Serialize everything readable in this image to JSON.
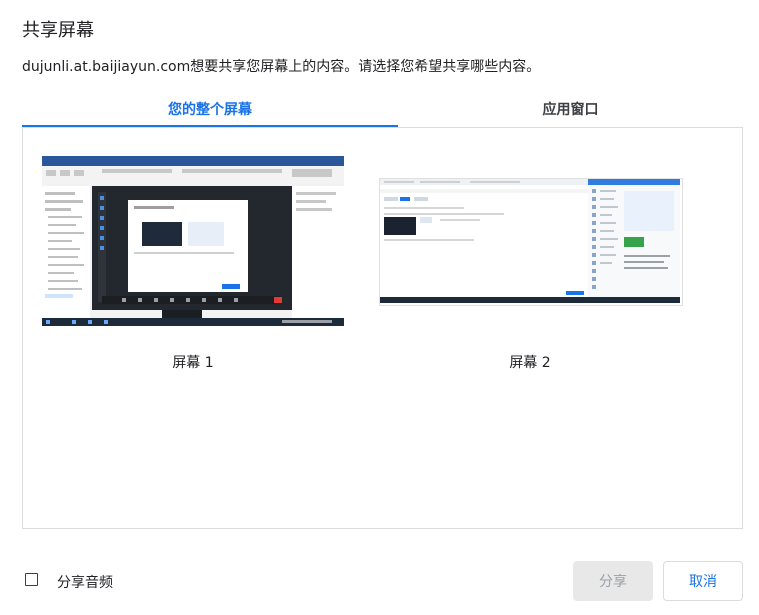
{
  "dialog": {
    "title": "共享屏幕",
    "description": "dujunli.at.baijiayun.com想要共享您屏幕上的内容。请选择您希望共享哪些内容。"
  },
  "tabs": [
    {
      "label": "您的整个屏幕",
      "active": true
    },
    {
      "label": "应用窗口",
      "active": false
    }
  ],
  "screens": [
    {
      "label": "屏幕 1"
    },
    {
      "label": "屏幕 2"
    }
  ],
  "footer": {
    "share_audio_label": "分享音频",
    "share_audio_checked": false,
    "share_button": "分享",
    "cancel_button": "取消"
  },
  "colors": {
    "accent": "#1a73e8",
    "disabled_button_bg": "#e8e8e8"
  }
}
